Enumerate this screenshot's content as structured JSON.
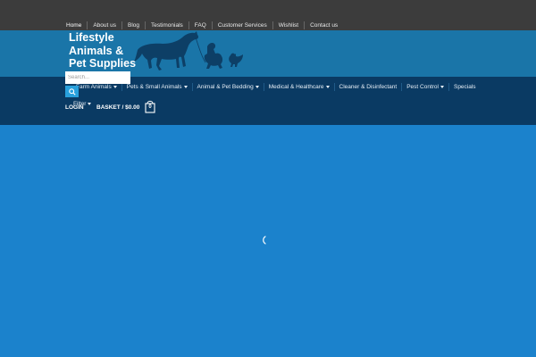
{
  "top_nav": {
    "items": [
      "Home",
      "About us",
      "Blog",
      "Testimonials",
      "FAQ",
      "Customer Services",
      "Wishlist",
      "Contact us"
    ]
  },
  "logo": {
    "line1": "Lifestyle",
    "line2": "Animals &",
    "line3": "Pet Supplies",
    "art_icon": "horse-dog-chicken-silhouette-icon"
  },
  "main_nav": {
    "items": [
      "Farm Animals",
      "Pets & Small Animals",
      "Animal & Pet Bedding",
      "Medical & Healthcare",
      "Cleaner & Disinfectant",
      "Pest Control",
      "Specials"
    ]
  },
  "search": {
    "placeholder": "Search..."
  },
  "filter": {
    "label": "Filter"
  },
  "account": {
    "login_label": "LOGIN",
    "basket_label": "BASKET / $0.00",
    "basket_count": "0"
  },
  "colors": {
    "top_bar": "#3c3c3c",
    "logo_band": "#1a75a8",
    "nav_band": "#0a3a63",
    "content": "#1b82cc",
    "search_button": "#28a0dc"
  }
}
